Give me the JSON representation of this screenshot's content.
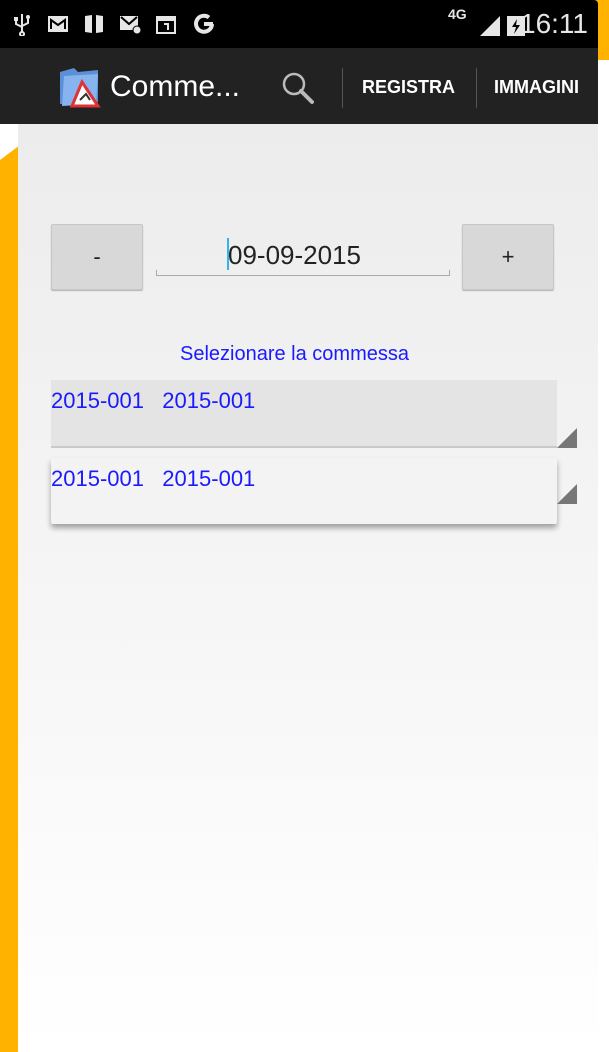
{
  "status_bar": {
    "network": "4G",
    "time": "16:11"
  },
  "action_bar": {
    "title": "Comme...",
    "actions": [
      "REGISTRA",
      "IMMAGINI"
    ]
  },
  "date_control": {
    "decrement_label": "-",
    "date_value": "09-09-2015",
    "increment_label": "+"
  },
  "job_selector": {
    "label": "Selezionare la commessa",
    "primary_value": "2015-001   2015-001",
    "secondary_value": "2015-001   2015-001"
  },
  "colors": {
    "accent_orange": "#ffb300",
    "link_blue": "#1a1aff",
    "action_bar": "#222222",
    "cursor": "#33b5e5"
  }
}
